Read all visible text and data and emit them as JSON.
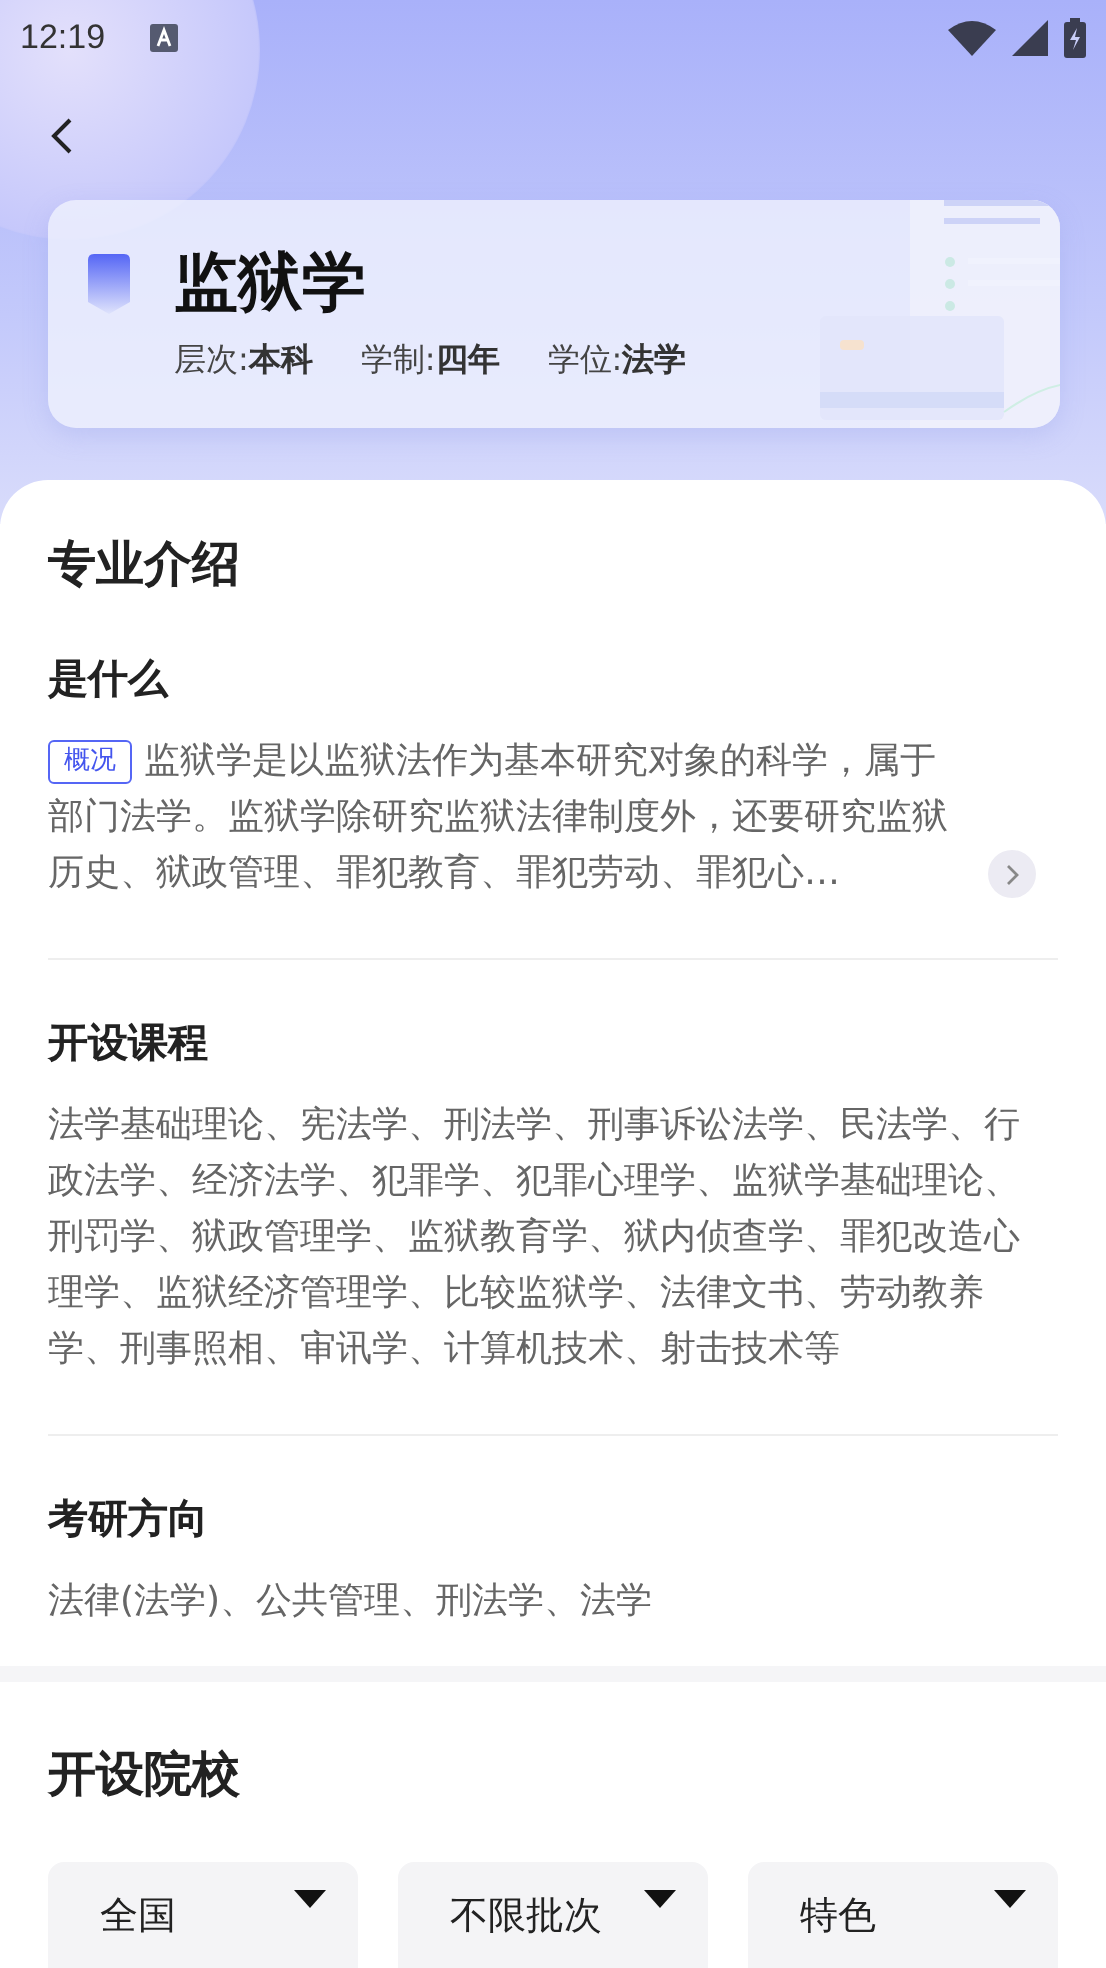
{
  "status_bar": {
    "time": "12:19"
  },
  "major": {
    "name": "监狱学",
    "facts": [
      {
        "label": "层次:",
        "value": "本科"
      },
      {
        "label": "学制:",
        "value": "四年"
      },
      {
        "label": "学位:",
        "value": "法学"
      }
    ]
  },
  "intro": {
    "title": "专业介绍",
    "what": {
      "title": "是什么",
      "tag": "概况",
      "text": "监狱学是以监狱法作为基本研究对象的科学，属于部门法学。监狱学除研究监狱法律制度外，还要研究监狱历史、狱政管理、罪犯教育、罪犯劳动、罪犯心…"
    },
    "courses": {
      "title": "开设课程",
      "text": "法学基础理论、宪法学、刑法学、刑事诉讼法学、民法学、行政法学、经济法学、犯罪学、犯罪心理学、监狱学基础理论、刑罚学、狱政管理学、监狱教育学、狱内侦查学、罪犯改造心理学、监狱经济管理学、比较监狱学、法律文书、劳动教养学、刑事照相、审讯学、计算机技术、射击技术等"
    },
    "postgrad": {
      "title": "考研方向",
      "text": "法律(法学)、公共管理、刑法学、法学"
    }
  },
  "schools": {
    "title": "开设院校",
    "filters": [
      {
        "label": "全国"
      },
      {
        "label": "不限批次"
      },
      {
        "label": "特色"
      }
    ]
  }
}
